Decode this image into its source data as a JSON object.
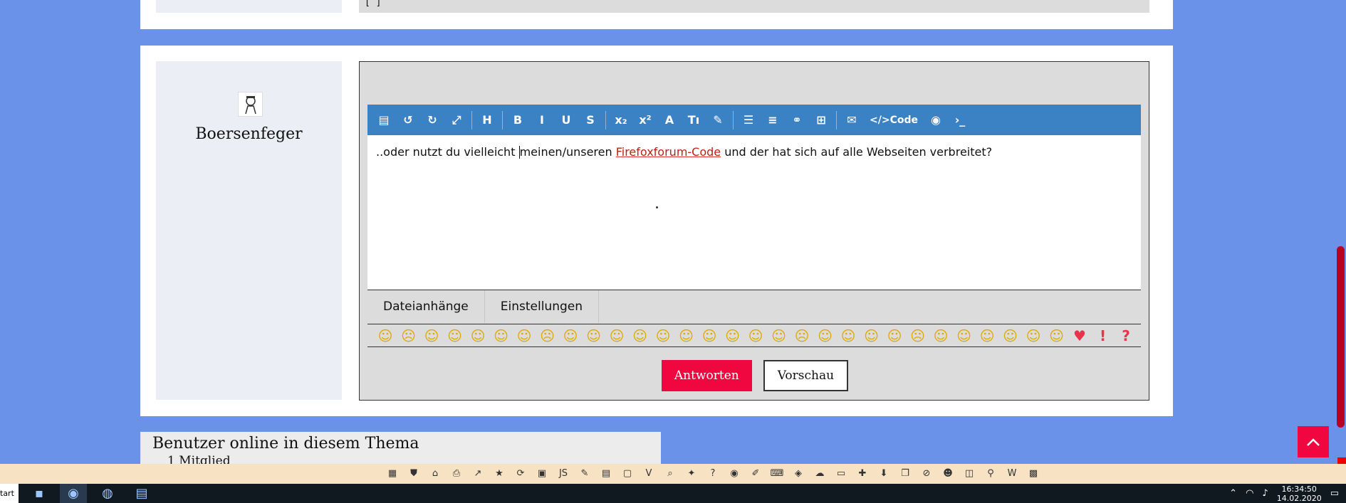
{
  "top_post": {
    "snippet": "[ ]"
  },
  "post": {
    "author": "Boersenfeger",
    "avatar_icon": "avatar-cartoon-icon",
    "toolbar": [
      {
        "name": "source-view-icon",
        "glyph": "▤"
      },
      {
        "name": "undo-icon",
        "glyph": "↺"
      },
      {
        "name": "redo-icon",
        "glyph": "↻"
      },
      {
        "name": "fullscreen-icon",
        "glyph": "⤢"
      },
      {
        "sep": true
      },
      {
        "name": "heading-icon",
        "glyph": "H"
      },
      {
        "sep": true
      },
      {
        "name": "bold-icon",
        "glyph": "B"
      },
      {
        "name": "italic-icon",
        "glyph": "I"
      },
      {
        "name": "underline-icon",
        "glyph": "U"
      },
      {
        "name": "strikethrough-icon",
        "glyph": "S"
      },
      {
        "sep": true
      },
      {
        "name": "subscript-icon",
        "glyph": "x₂"
      },
      {
        "name": "superscript-icon",
        "glyph": "x²"
      },
      {
        "name": "font-size-icon",
        "glyph": "A"
      },
      {
        "name": "font-family-icon",
        "glyph": "Tı"
      },
      {
        "name": "paint-brush-icon",
        "glyph": "✎"
      },
      {
        "sep": true
      },
      {
        "name": "list-icon",
        "glyph": "☰"
      },
      {
        "name": "align-icon",
        "glyph": "≡"
      },
      {
        "name": "link-icon",
        "glyph": "⚭"
      },
      {
        "name": "table-icon",
        "glyph": "⊞"
      },
      {
        "sep": true
      },
      {
        "name": "quote-icon",
        "glyph": "✉"
      },
      {
        "name": "code-button",
        "glyph": "</>Code"
      },
      {
        "name": "spoiler-icon",
        "glyph": "◉"
      },
      {
        "name": "terminal-icon",
        "glyph": "›_"
      }
    ],
    "text_before": "..oder nutzt du vielleicht ",
    "text_mid": "meinen/unseren ",
    "text_link": "Firefoxforum-Code",
    "text_after": " und der hat sich auf alle Webseiten verbreitet?",
    "tabs": [
      "Dateianhänge",
      "Einstellungen"
    ],
    "smileys": [
      "☺",
      "☹",
      "☺",
      "☺",
      "☺",
      "☺",
      "☺",
      "☹",
      "☺",
      "☺",
      "☺",
      "☺",
      "☺",
      "☺",
      "☺",
      "☺",
      "☺",
      "☺",
      "☹",
      "☺",
      "☺",
      "☺",
      "☺",
      "☹",
      "☺",
      "☺",
      "☺",
      "☺",
      "☺",
      "☺",
      "♥",
      "!",
      "?"
    ],
    "submit_label": "Antworten",
    "preview_label": "Vorschau"
  },
  "online": {
    "title": "Benutzer online in diesem Thema",
    "count": "1 Mitglied"
  },
  "taskbar": {
    "start": "tart",
    "clock_time": "16:34:50",
    "clock_date": "14.02.2020"
  },
  "colors": {
    "page_bg": "#6a92e8",
    "toolbar": "#3b82c4",
    "accent": "#f0073f"
  }
}
